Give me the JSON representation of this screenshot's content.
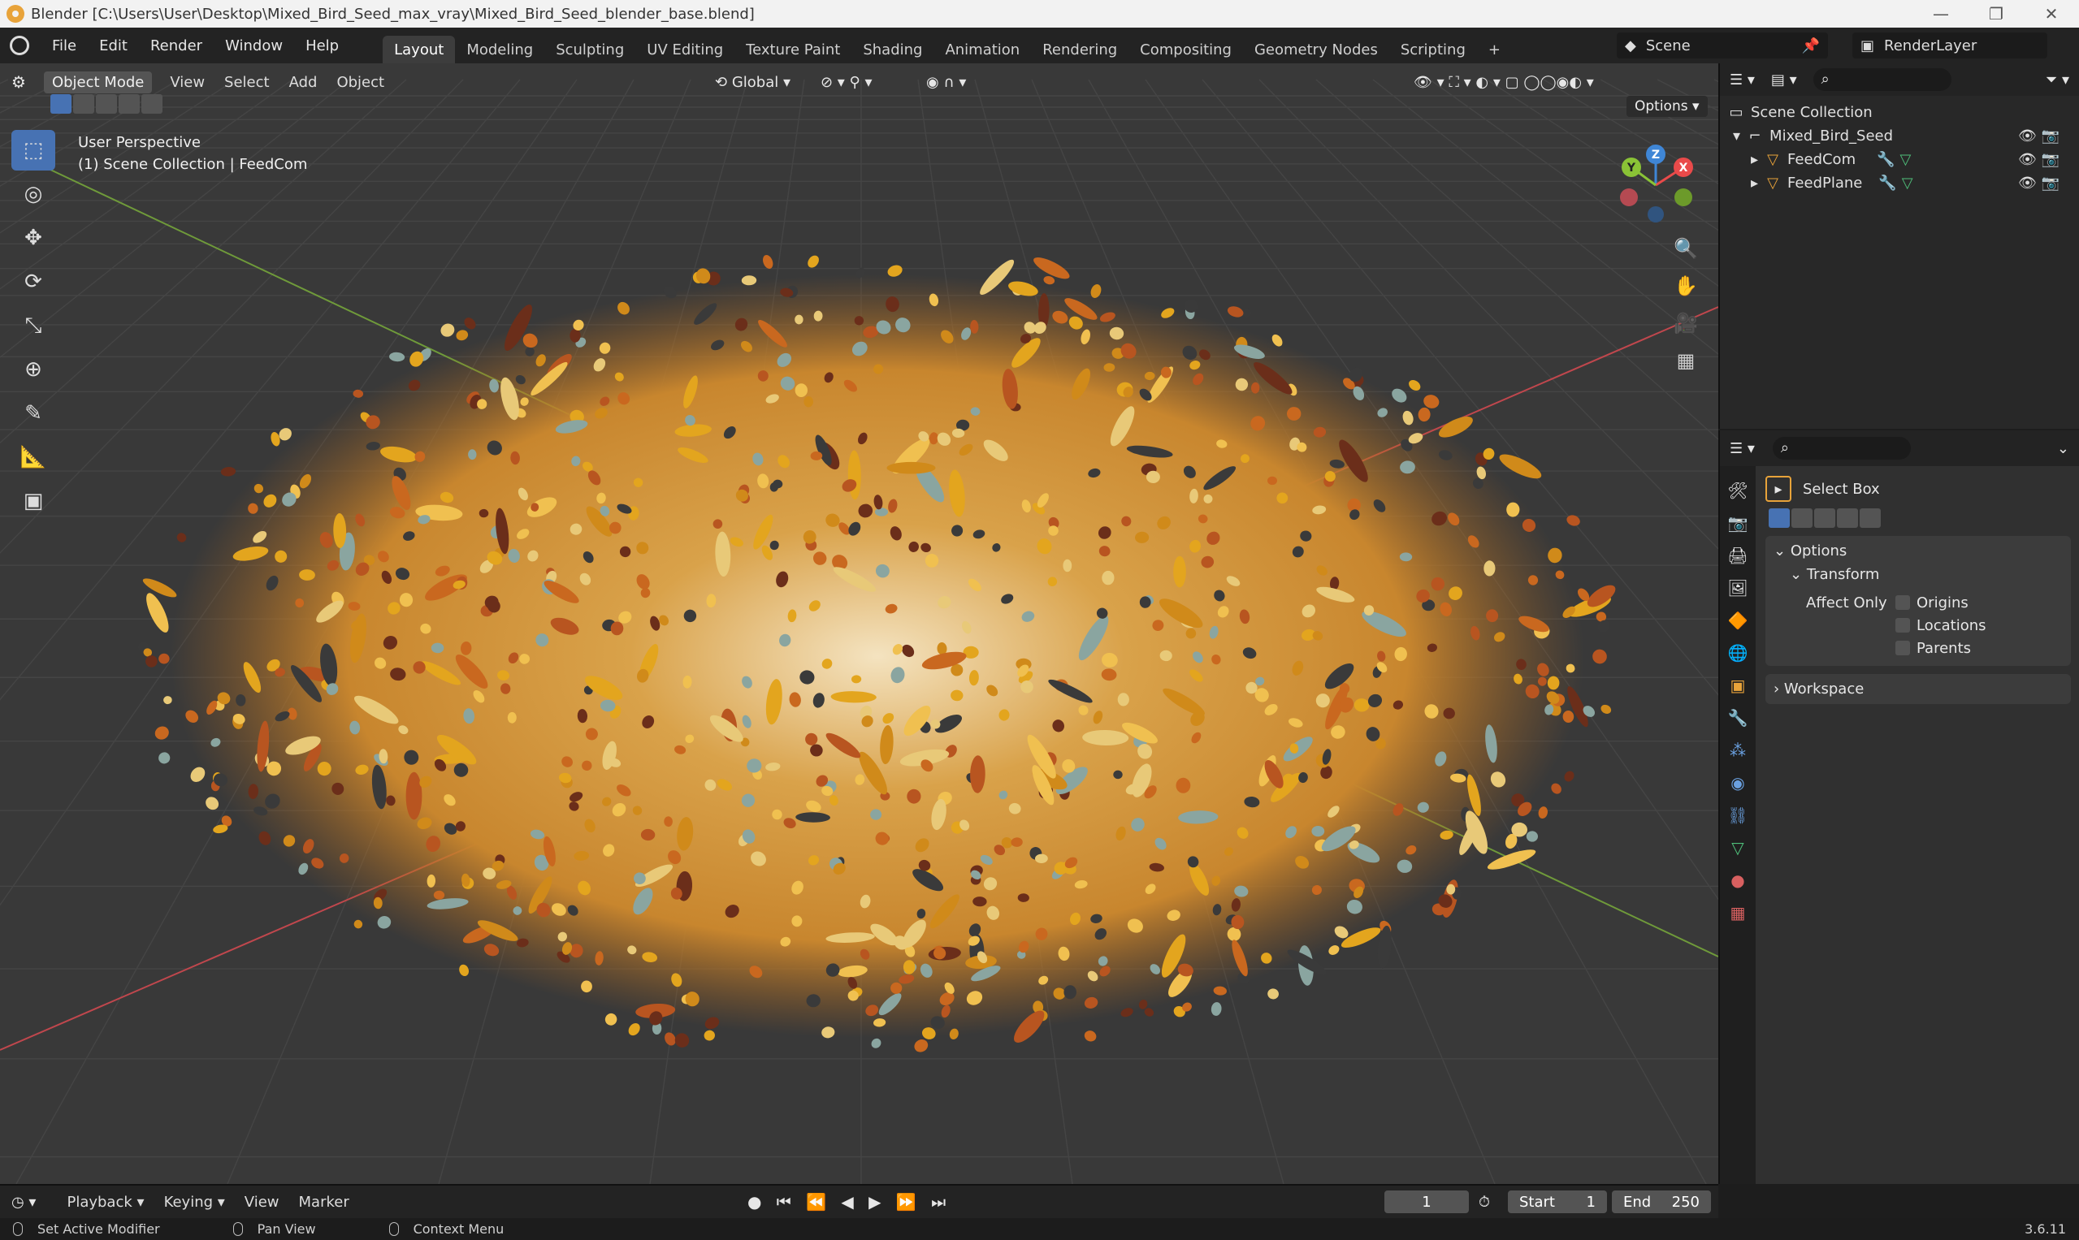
{
  "window": {
    "title": "Blender [C:\\Users\\User\\Desktop\\Mixed_Bird_Seed_max_vray\\Mixed_Bird_Seed_blender_base.blend]"
  },
  "menu": {
    "file": "File",
    "edit": "Edit",
    "render": "Render",
    "window": "Window",
    "help": "Help"
  },
  "workspaces": [
    "Layout",
    "Modeling",
    "Sculpting",
    "UV Editing",
    "Texture Paint",
    "Shading",
    "Animation",
    "Rendering",
    "Compositing",
    "Geometry Nodes",
    "Scripting"
  ],
  "scene": {
    "name": "Scene",
    "render_layer": "RenderLayer"
  },
  "viewport": {
    "mode": "Object Mode",
    "view": "View",
    "select": "Select",
    "add": "Add",
    "object": "Object",
    "transform_orientation": "Global",
    "options": "Options",
    "perspective": "User Perspective",
    "collection_info": "(1) Scene Collection | FeedCom",
    "gizmo": {
      "x": "X",
      "y": "Y",
      "z": "Z"
    }
  },
  "outliner": {
    "root": "Scene Collection",
    "collection": "Mixed_Bird_Seed",
    "items": [
      {
        "name": "FeedCom"
      },
      {
        "name": "FeedPlane"
      }
    ]
  },
  "properties": {
    "tool": "Select Box",
    "options": "Options",
    "transform": "Transform",
    "affect_only": "Affect Only",
    "origins": "Origins",
    "locations": "Locations",
    "parents": "Parents",
    "workspace": "Workspace"
  },
  "timeline": {
    "playback": "Playback",
    "keying": "Keying",
    "view": "View",
    "marker": "Marker",
    "current_frame": "1",
    "start_label": "Start",
    "start": "1",
    "end_label": "End",
    "end": "250"
  },
  "status": {
    "left": "Set Active Modifier",
    "middle": "Pan View",
    "right": "Context Menu",
    "version": "3.6.11"
  },
  "colors": {
    "accent": "#4772b3",
    "x_axis": "#e94a4a",
    "y_axis": "#8ac336",
    "z_axis": "#3f86d6"
  }
}
